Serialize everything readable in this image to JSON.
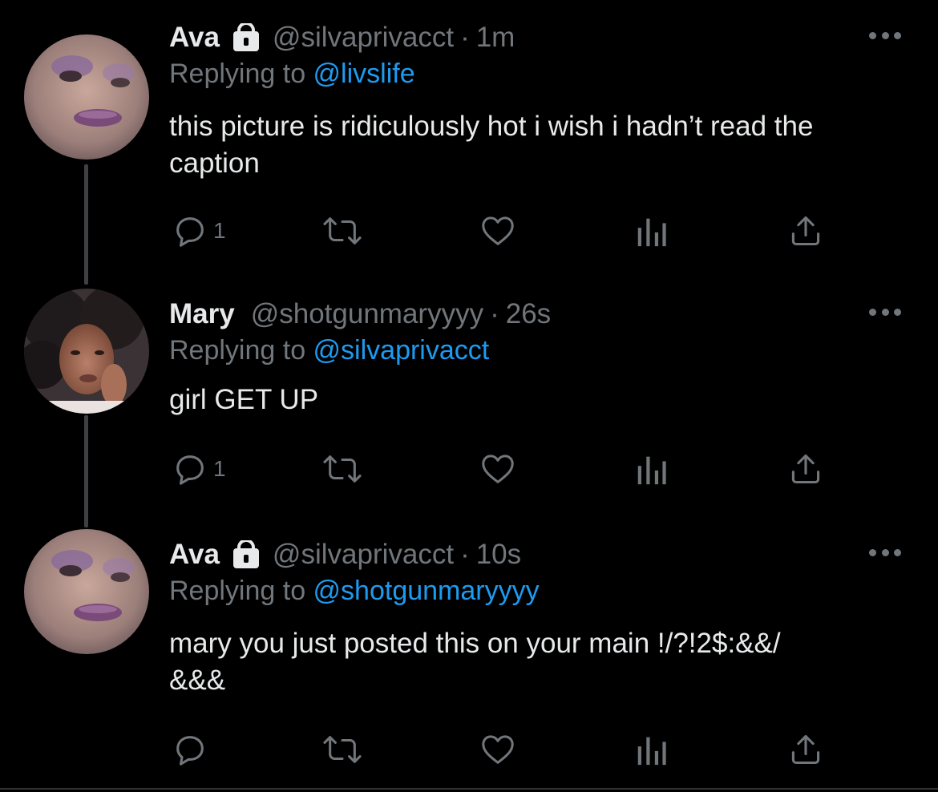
{
  "colors": {
    "background": "#000000",
    "text": "#e7e9ea",
    "muted": "#71767b",
    "link": "#1d9bf0"
  },
  "tweets": [
    {
      "name": "Ava",
      "protected": true,
      "handle": "@silvaprivacct",
      "separator": "·",
      "time": "1m",
      "replying_prefix": "Replying to ",
      "replying_to": "@livslife",
      "text": "this picture is ridiculously hot i wish i hadn’t read the caption",
      "reply_count": "1",
      "icons": [
        "reply-icon",
        "retweet-icon",
        "like-icon",
        "analytics-icon",
        "share-icon",
        "more-icon",
        "lock-icon"
      ]
    },
    {
      "name": "Mary",
      "protected": false,
      "handle": "@shotgunmaryyyy",
      "separator": "·",
      "time": "26s",
      "replying_prefix": "Replying to ",
      "replying_to": "@silvaprivacct",
      "text": "girl GET UP",
      "reply_count": "1",
      "icons": [
        "reply-icon",
        "retweet-icon",
        "like-icon",
        "analytics-icon",
        "share-icon",
        "more-icon"
      ]
    },
    {
      "name": "Ava",
      "protected": true,
      "handle": "@silvaprivacct",
      "separator": "·",
      "time": "10s",
      "replying_prefix": "Replying to ",
      "replying_to": "@shotgunmaryyyy",
      "text_line1": "mary you just posted this on your main !/?!2$:&&/",
      "text_line2": "&&&",
      "reply_count": "",
      "icons": [
        "reply-icon",
        "retweet-icon",
        "like-icon",
        "analytics-icon",
        "share-icon",
        "more-icon",
        "lock-icon"
      ]
    }
  ]
}
